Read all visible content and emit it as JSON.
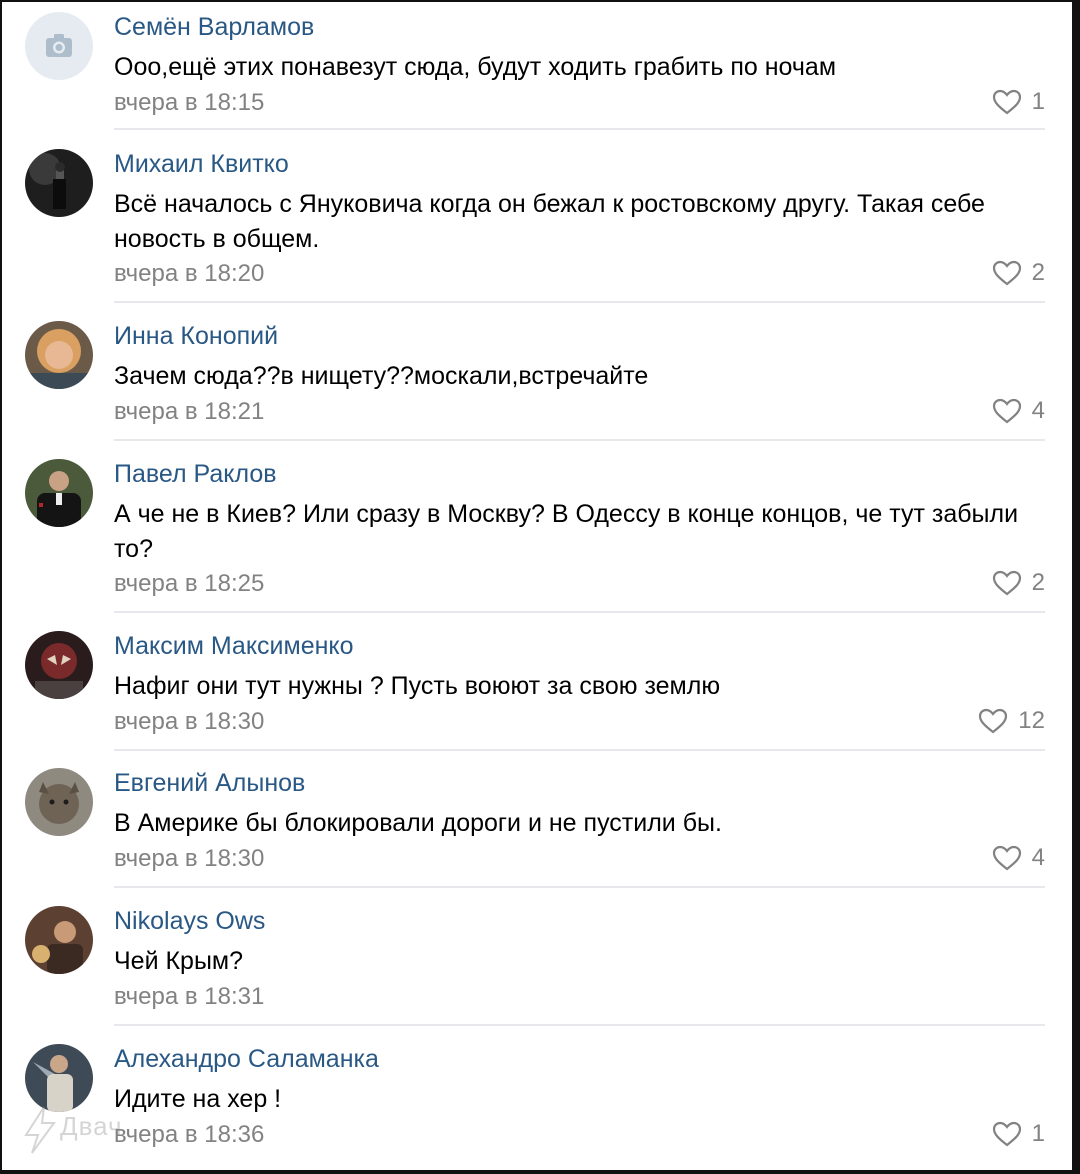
{
  "comments": [
    {
      "author": "Семён Варламов",
      "text": "Ооо,ещё этих понавезут сюда, будут ходить грабить по ночам",
      "date": "вчера в 18:15",
      "likes": "1",
      "avatar": "camera-placeholder"
    },
    {
      "author": "Михаил Квитко",
      "text": "Всё началось с Януковича когда он бежал к ростовскому другу. Такая себе новость в общем.",
      "date": "вчера в 18:20",
      "likes": "2",
      "avatar": "photo"
    },
    {
      "author": "Инна Конопий",
      "text": "Зачем сюда??в нищету??москали,встречайте",
      "date": "вчера в 18:21",
      "likes": "4",
      "avatar": "photo"
    },
    {
      "author": "Павел Раклов",
      "text": "А че не в Киев? Или сразу в Москву? В Одессу в конце концов, че тут забыли то?",
      "date": "вчера в 18:25",
      "likes": "2",
      "avatar": "photo"
    },
    {
      "author": "Максим Максименко",
      "text": "Нафиг они тут нужны ? Пусть воюют за свою землю",
      "date": "вчера в 18:30",
      "likes": "12",
      "avatar": "photo"
    },
    {
      "author": "Евгений Алынов",
      "text": "В Америке бы блокировали дороги и не пустили бы.",
      "date": "вчера в 18:30",
      "likes": "4",
      "avatar": "photo"
    },
    {
      "author": "Nikolays Ows",
      "text": "Чей Крым?",
      "date": "вчера в 18:31",
      "likes": "",
      "avatar": "photo"
    },
    {
      "author": "Алехандро Саламанка",
      "text": "Идите на хер !",
      "date": "вчера в 18:36",
      "likes": "1",
      "avatar": "photo"
    }
  ],
  "watermark": {
    "text": "Двач"
  },
  "colors": {
    "author": "#2a5885",
    "meta": "#828282",
    "divider": "#e7e8ec"
  },
  "icons": {
    "like": "heart-outline-icon",
    "placeholder": "camera-icon"
  }
}
